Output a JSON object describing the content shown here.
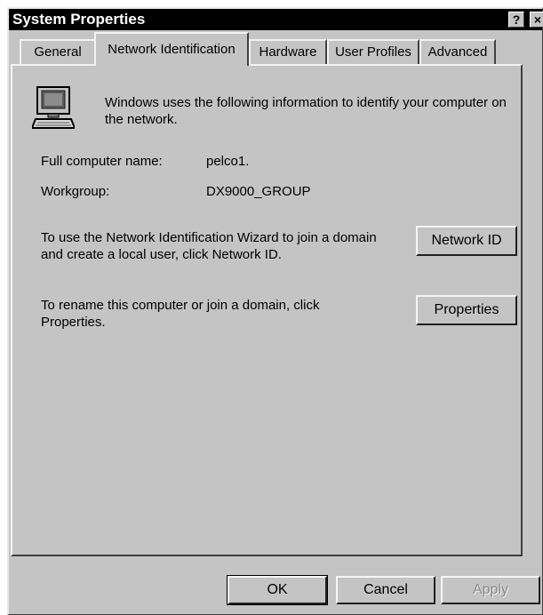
{
  "window": {
    "title": "System Properties",
    "help_glyph": "?",
    "close_glyph": "×"
  },
  "tabs": [
    {
      "label": "General"
    },
    {
      "label": "Network Identification"
    },
    {
      "label": "Hardware"
    },
    {
      "label": "User Profiles"
    },
    {
      "label": "Advanced"
    }
  ],
  "panel": {
    "intro": "Windows uses the following information to identify your computer on the network.",
    "full_name_label": "Full computer name:",
    "full_name_value": "pelco1.",
    "workgroup_label": "Workgroup:",
    "workgroup_value": "DX9000_GROUP",
    "wizard_text": "To use the Network Identification Wizard to join a domain and create a local user, click Network ID.",
    "network_id_button": "Network ID",
    "rename_text": "To rename this computer or join a domain, click Properties.",
    "properties_button": "Properties"
  },
  "footer": {
    "ok": "OK",
    "cancel": "Cancel",
    "apply": "Apply"
  },
  "icons": {
    "computer": "computer-icon"
  }
}
